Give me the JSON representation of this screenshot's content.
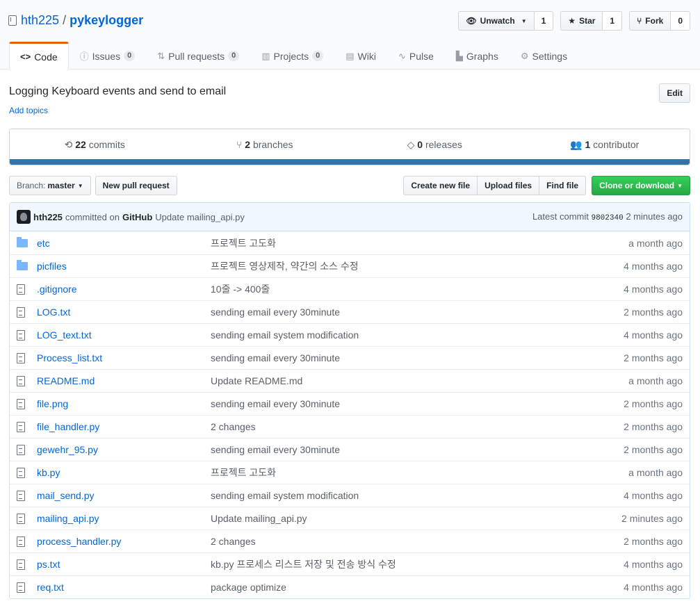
{
  "repo": {
    "owner": "hth225",
    "separator": "/",
    "name": "pykeylogger"
  },
  "actions": {
    "watch": {
      "label": "Unwatch",
      "count": "1"
    },
    "star": {
      "label": "Star",
      "count": "1"
    },
    "fork": {
      "label": "Fork",
      "count": "0"
    }
  },
  "tabs": [
    {
      "label": "Code",
      "icon": "code-icon",
      "counter": null
    },
    {
      "label": "Issues",
      "icon": "issue-icon",
      "counter": "0"
    },
    {
      "label": "Pull requests",
      "icon": "pull-request-icon",
      "counter": "0"
    },
    {
      "label": "Projects",
      "icon": "project-icon",
      "counter": "0"
    },
    {
      "label": "Wiki",
      "icon": "book-icon",
      "counter": null
    },
    {
      "label": "Pulse",
      "icon": "pulse-icon",
      "counter": null
    },
    {
      "label": "Graphs",
      "icon": "graph-icon",
      "counter": null
    },
    {
      "label": "Settings",
      "icon": "gear-icon",
      "counter": null
    }
  ],
  "description": "Logging Keyboard events and send to email",
  "add_topics": "Add topics",
  "edit_label": "Edit",
  "summary": {
    "commits": {
      "num": "22",
      "label": "commits"
    },
    "branches": {
      "num": "2",
      "label": "branches"
    },
    "releases": {
      "num": "0",
      "label": "releases"
    },
    "contributors": {
      "num": "1",
      "label": "contributor"
    },
    "language_color": "#3572A5"
  },
  "file_nav": {
    "branch_label": "Branch:",
    "branch_value": "master",
    "new_pr": "New pull request",
    "create_file": "Create new file",
    "upload_files": "Upload files",
    "find_file": "Find file",
    "clone": "Clone or download"
  },
  "latest_commit": {
    "author": "hth225",
    "via": "committed on",
    "platform": "GitHub",
    "message": "Update mailing_api.py",
    "label": "Latest commit",
    "sha": "9802340",
    "age": "2 minutes ago"
  },
  "files": [
    {
      "type": "dir",
      "name": "etc",
      "message": "프로젝트 고도화",
      "age": "a month ago"
    },
    {
      "type": "dir",
      "name": "picfiles",
      "message": "프로젝트 영상제작, 약간의 소스 수정",
      "age": "4 months ago"
    },
    {
      "type": "file",
      "name": ".gitignore",
      "message": "10줄 -> 400줄",
      "age": "4 months ago"
    },
    {
      "type": "file",
      "name": "LOG.txt",
      "message": "sending email every 30minute",
      "age": "2 months ago"
    },
    {
      "type": "file",
      "name": "LOG_text.txt",
      "message": "sending email system modification",
      "age": "4 months ago"
    },
    {
      "type": "file",
      "name": "Process_list.txt",
      "message": "sending email every 30minute",
      "age": "2 months ago"
    },
    {
      "type": "file",
      "name": "README.md",
      "message": "Update README.md",
      "age": "a month ago"
    },
    {
      "type": "file",
      "name": "file.png",
      "message": "sending email every 30minute",
      "age": "2 months ago"
    },
    {
      "type": "file",
      "name": "file_handler.py",
      "message": "2 changes",
      "age": "2 months ago"
    },
    {
      "type": "file",
      "name": "gewehr_95.py",
      "message": "sending email every 30minute",
      "age": "2 months ago"
    },
    {
      "type": "file",
      "name": "kb.py",
      "message": "프로젝트 고도화",
      "age": "a month ago"
    },
    {
      "type": "file",
      "name": "mail_send.py",
      "message": "sending email system modification",
      "age": "4 months ago"
    },
    {
      "type": "file",
      "name": "mailing_api.py",
      "message": "Update mailing_api.py",
      "age": "2 minutes ago"
    },
    {
      "type": "file",
      "name": "process_handler.py",
      "message": "2 changes",
      "age": "2 months ago"
    },
    {
      "type": "file",
      "name": "ps.txt",
      "message": "kb.py 프로세스 리스트 저장 및 전송 방식 수정",
      "age": "4 months ago"
    },
    {
      "type": "file",
      "name": "req.txt",
      "message": "package optimize",
      "age": "4 months ago"
    }
  ]
}
